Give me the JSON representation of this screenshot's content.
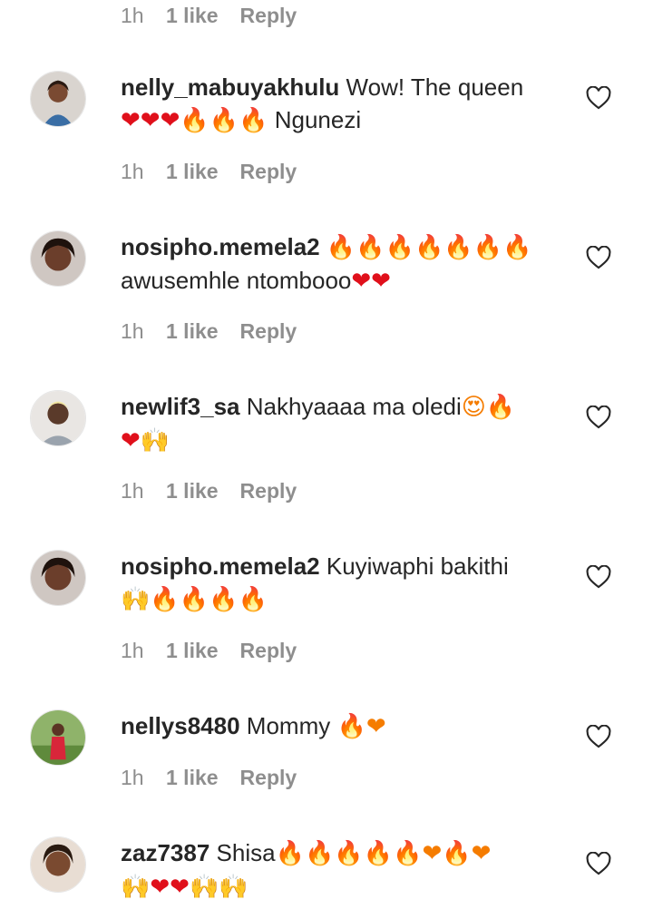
{
  "top_meta": {
    "time": "1h",
    "likes": "1 like",
    "reply": "Reply"
  },
  "comments": [
    {
      "username": "nelly_mabuyakhulu",
      "text_line1": "Wow! The queen",
      "text_line2_emoji": "❤❤❤🔥🔥🔥",
      "text_line2": " Ngunezi",
      "time": "1h",
      "likes": "1 like",
      "reply": "Reply"
    },
    {
      "username": "nosipho.memela2",
      "text_line1_emoji": "🔥🔥🔥🔥🔥🔥🔥",
      "text_line2": "awusemhle ntombooo",
      "text_line2_emoji": "❤❤",
      "time": "1h",
      "likes": "1 like",
      "reply": "Reply"
    },
    {
      "username": "newlif3_sa",
      "text_line1": "Nakhyaaaa ma oledi",
      "text_line1_emoji": "😍🔥",
      "text_line2_emoji": "❤🙌",
      "time": "1h",
      "likes": "1 like",
      "reply": "Reply"
    },
    {
      "username": "nosipho.memela2",
      "text_line1": "Kuyiwaphi bakithi",
      "text_line2_emoji": "🙌🔥🔥🔥🔥",
      "time": "1h",
      "likes": "1 like",
      "reply": "Reply"
    },
    {
      "username": "nellys8480",
      "text_line1": "Mommy",
      "text_line1_emoji": "🔥❤",
      "time": "1h",
      "likes": "1 like",
      "reply": "Reply"
    },
    {
      "username": "zaz7387",
      "text_line1": "Shisa",
      "text_line1_emoji": "🔥🔥🔥🔥🔥❤🔥❤",
      "text_line2_emoji": "🙌❤❤🙌🙌"
    }
  ],
  "icons": {
    "like": "heart-outline-icon"
  },
  "colors": {
    "meta_gray": "#8e8e8e",
    "text": "#262626",
    "heart": "#e0101b",
    "fire": "#f57c00"
  }
}
